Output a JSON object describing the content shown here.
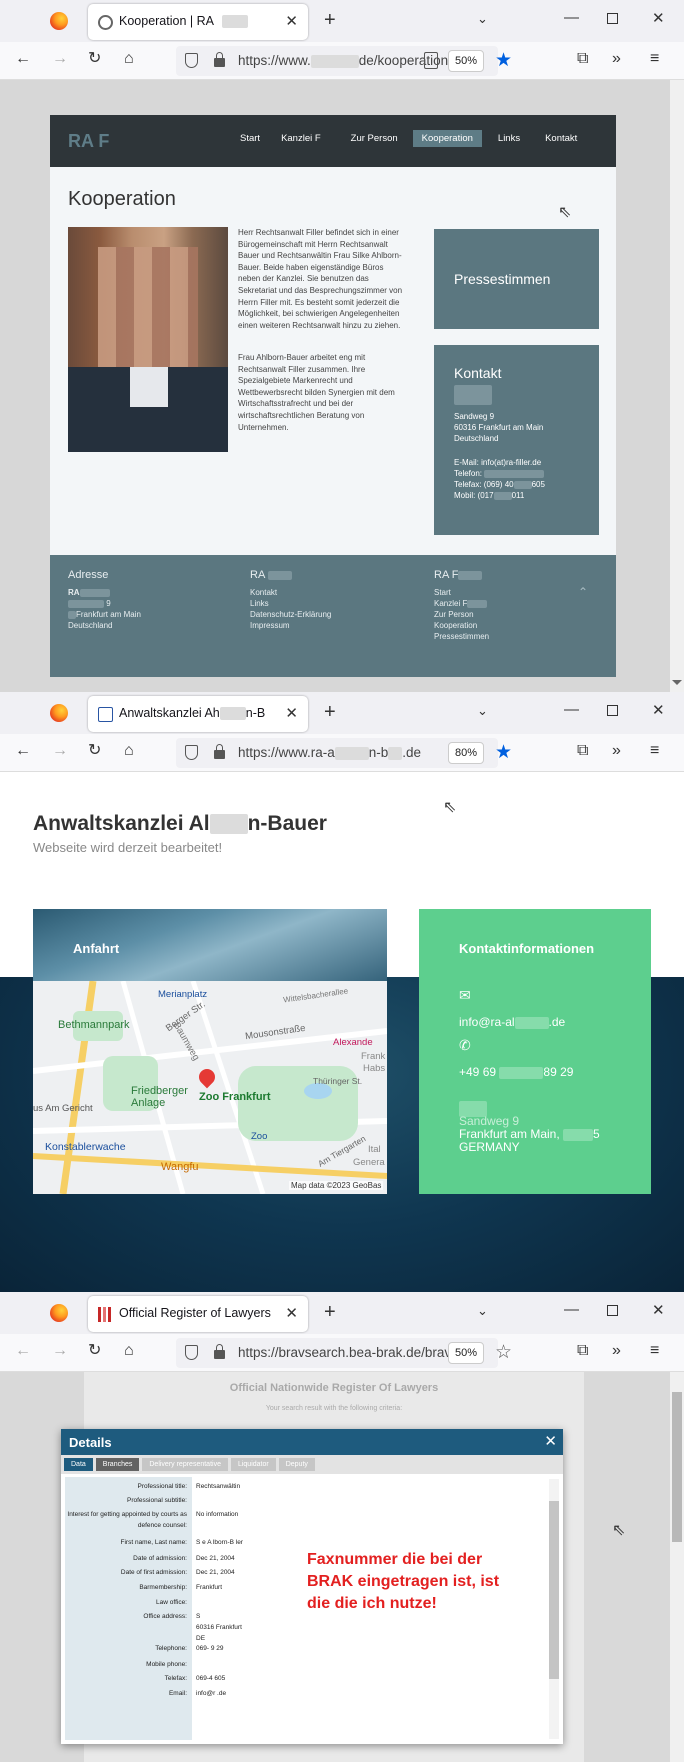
{
  "w1": {
    "tab_title": "Kooperation | RA",
    "url": "https://www.",
    "url_tail": "de/kooperation",
    "zoom": "50%",
    "site": {
      "logo": "RA F",
      "menu": [
        "Start",
        "Kanzlei F",
        "Zur Person",
        "Kooperation",
        "Links",
        "Kontakt"
      ],
      "heading": "Kooperation",
      "p1": "Herr Rechtsanwalt Filler befindet sich in einer Bürogemeinschaft mit Herrn Rechtsanwalt Bauer und Rechtsanwältin Frau Silke Ahlborn-Bauer. Beide haben eigenständige Büros neben der Kanzlei. Sie benutzen das Sekretariat und das Besprechungszimmer von Herrn Filler mit. Es besteht somit jederzeit die Möglichkeit, bei schwierigen Angelegenheiten einen weiteren Rechtsanwalt hinzu zu ziehen.",
      "p2": "Frau Ahlborn-Bauer arbeitet eng mit Rechtsanwalt Filler zusammen. Ihre Spezialgebiete Markenrecht und Wettbewerbsrecht bilden Synergien mit dem Wirtschaftsstrafrecht und bei der wirtschaftsrechtlichen Beratung von Unternehmen.",
      "press": "Pressestimmen",
      "kontakt": "Kontakt",
      "addr1": "Sandweg 9",
      "addr2": "60316 Frankfurt am Main",
      "addr3": "Deutschland",
      "email": "E-Mail: info(at)ra-filler.de",
      "tel": "Telefon:",
      "fax": "Telefax: (069) 40",
      "fax_end": "605",
      "mobil": "Mobil: (017",
      "mobil_end": "011",
      "f_c1_h": "Adresse",
      "f_c1": [
        "RA",
        "9",
        "Frankfurt am Main",
        "Deutschland"
      ],
      "f_c2_h": "RA",
      "f_c2": [
        "Kontakt",
        "Links",
        "Datenschutz-Erklärung",
        "Impressum"
      ],
      "f_c3_h": "RA F",
      "f_c3": [
        "Start",
        "Kanzlei F",
        "Zur Person",
        "Kooperation",
        "Pressestimmen"
      ]
    }
  },
  "w2": {
    "tab_title": "Anwaltskanzlei Ah",
    "tab_title_end": "n-B",
    "url": "https://www.ra-a",
    "url_mid": "n-b",
    "url_end": ".de",
    "zoom": "80%",
    "site": {
      "title": "Anwaltskanzlei Al",
      "title_end": "n-Bauer",
      "subtitle": "Webseite wird derzeit bearbeitet!",
      "anfahrt": "Anfahrt",
      "kontakt_h": "Kontaktinformationen",
      "email": "info@ra-al",
      "email_end": ".de",
      "phone": "+49 69",
      "phone_end": "89 29",
      "street": "Sandweg 9",
      "city": "Frankfurt am Main,",
      "country": "GERMANY",
      "map": {
        "merian": "Merianplatz",
        "bethmann": "Bethmannpark",
        "berger": "Berger Str.",
        "friedberger": "Friedberger Anlage",
        "gericht": "us Am Gericht",
        "konst": "Konstablerwache",
        "zoo": "Zoo Frankfurt",
        "zoo2": "Zoo",
        "wangfu": "Wangfu",
        "alexande": "Alexande",
        "frankh": "Frank",
        "habs": "Habs",
        "thuringer": "Thüringer St.",
        "mousson": "Mousonstraße",
        "baumweg": "Baumweg",
        "tiergarten": "Am Tiergarten",
        "ital": "Ital",
        "gener": "Genera",
        "copyright": "Map data ©2023 GeoBas",
        "wittelsbach": "Wittelsbacherallee"
      }
    }
  },
  "w3": {
    "tab_title": "Official Register of Lawyers",
    "url": "https://bravsearch.bea-brak.de/bravsear",
    "zoom": "50%",
    "bg_title": "Official Nationwide Register Of Lawyers",
    "bg_sub": "Your search result with the following criteria:",
    "modal": {
      "title": "Details",
      "tabs": [
        "Data",
        "Branches",
        "Delivery representative",
        "Liquidator",
        "Deputy"
      ],
      "rows": [
        [
          "Professional title:",
          "Rechtsanwältin"
        ],
        [
          "Professional subtitle:",
          ""
        ],
        [
          "Interest for getting appointed by courts as defence counsel:",
          "No information"
        ],
        [
          "First name, Last name:",
          "S  e A  lborn-B  ler"
        ],
        [
          "Date of admission:",
          "Dec 21, 2004"
        ],
        [
          "Date of first admission:",
          "Dec 21, 2004"
        ],
        [
          "Barmembership:",
          "Frankfurt"
        ],
        [
          "Law office:",
          ""
        ],
        [
          "Office address:",
          "S\n60316 Frankfurt\nDE"
        ],
        [
          "Telephone:",
          "069-  9 29"
        ],
        [
          "Mobile phone:",
          ""
        ],
        [
          "Telefax:",
          "069-4  605"
        ],
        [
          "Email:",
          "info@r  .de"
        ]
      ]
    },
    "annotation": "Faxnummer die bei der BRAK eingetragen ist, ist die die ich nutze!"
  }
}
